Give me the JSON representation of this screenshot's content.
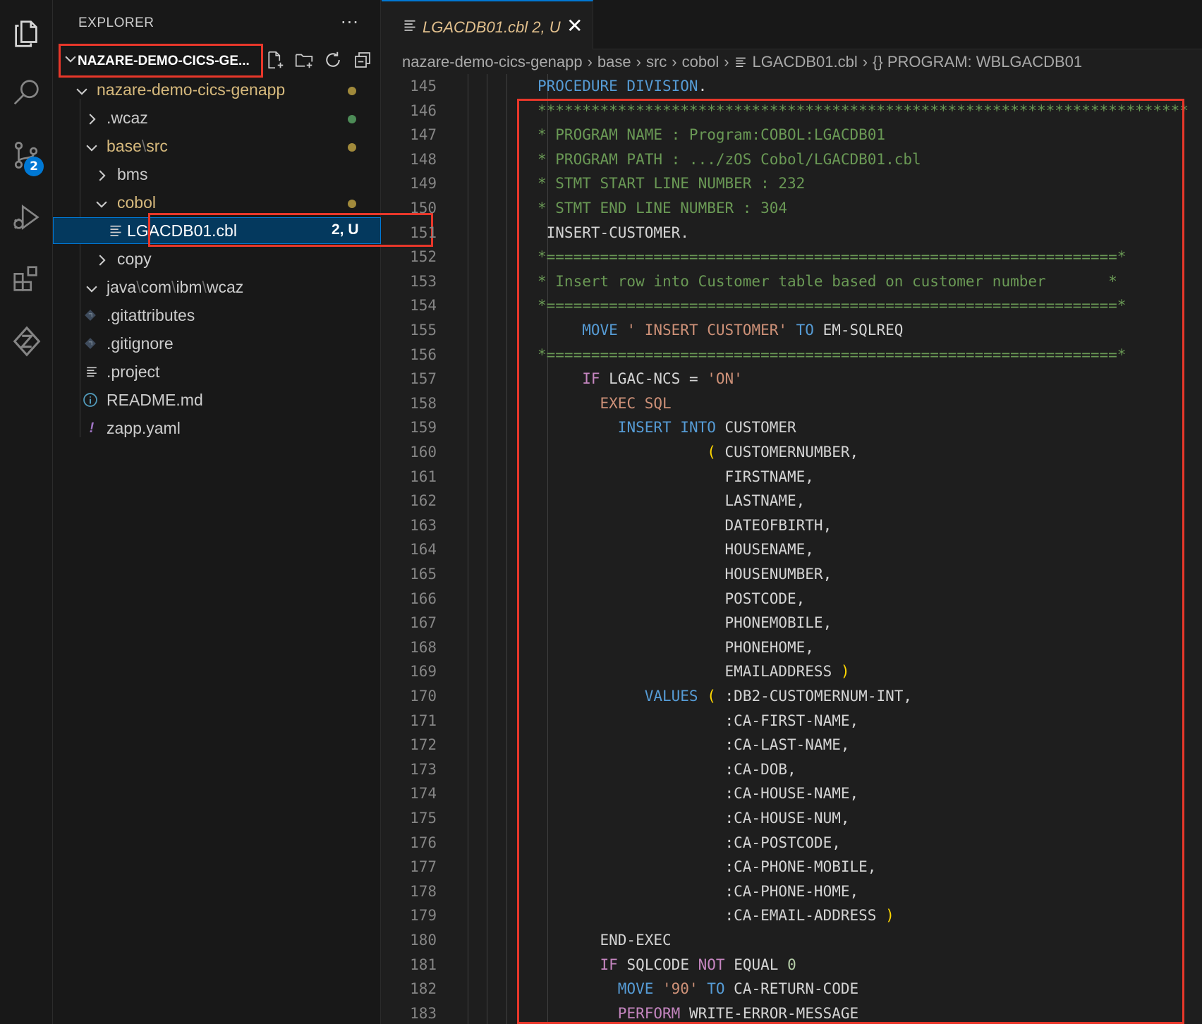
{
  "sidebar": {
    "title": "EXPLORER",
    "more": "···",
    "root": "NAZARE-DEMO-CICS-GE...",
    "tree": [
      {
        "label": "nazare-demo-cics-genapp"
      },
      {
        "label": ".wcaz"
      },
      {
        "label_parts": [
          "base",
          "\\",
          "src"
        ]
      },
      {
        "label": "bms"
      },
      {
        "label": "cobol"
      },
      {
        "label": "LGACDB01.cbl",
        "badge": "2, U"
      },
      {
        "label": "copy"
      },
      {
        "label_parts": [
          "java",
          "\\",
          "com",
          "\\",
          "ibm",
          "\\",
          "wcaz"
        ]
      },
      {
        "label": ".gitattributes"
      },
      {
        "label": ".gitignore"
      },
      {
        "label": ".project"
      },
      {
        "label": "README.md"
      },
      {
        "label": "zapp.yaml",
        "icon_text": "!"
      }
    ]
  },
  "activity_bar": {
    "scm_badge": "2",
    "icons": [
      "explorer-icon",
      "search-icon",
      "source-control-icon",
      "run-debug-icon",
      "extensions-icon",
      "z-open-editor-icon"
    ]
  },
  "editor": {
    "tab": {
      "label": "LGACDB01.cbl 2, U",
      "close": "✕"
    },
    "breadcrumb": [
      "nazare-demo-cics-genapp",
      "base",
      "src",
      "cobol",
      "LGACDB01.cbl",
      "{} PROGRAM: WBLGACDB01"
    ],
    "line_numbers": [
      "145",
      "146",
      "147",
      "148",
      "149",
      "150",
      "151",
      "152",
      "153",
      "154",
      "155",
      "156",
      "157",
      "158",
      "159",
      "160",
      "161",
      "162",
      "163",
      "164",
      "165",
      "166",
      "167",
      "168",
      "169",
      "170",
      "171",
      "172",
      "173",
      "174",
      "175",
      "176",
      "177",
      "178",
      "179",
      "180",
      "181",
      "182",
      "183"
    ],
    "lines": [
      [
        {
          "t": "PROCEDURE DIVISION",
          "c": "kw"
        },
        {
          "t": ".",
          "c": "wh"
        }
      ],
      [
        {
          "t": "*************************************************************************",
          "c": "cm"
        }
      ],
      [
        {
          "t": "* PROGRAM NAME : Program:COBOL:LGACDB01",
          "c": "cm"
        }
      ],
      [
        {
          "t": "* PROGRAM PATH : .../zOS Cobol/LGACDB01.cbl",
          "c": "cm"
        }
      ],
      [
        {
          "t": "* STMT START LINE NUMBER : 232",
          "c": "cm"
        }
      ],
      [
        {
          "t": "* STMT END LINE NUMBER : 304",
          "c": "cm"
        }
      ],
      [
        {
          "t": " INSERT-CUSTOMER.",
          "c": "wh"
        }
      ],
      [
        {
          "t": "*================================================================*",
          "c": "cm"
        }
      ],
      [
        {
          "t": "* Insert row into Customer table based on customer number       *",
          "c": "cm"
        }
      ],
      [
        {
          "t": "*================================================================*",
          "c": "cm"
        }
      ],
      [
        {
          "t": "     ",
          "c": "wh"
        },
        {
          "t": "MOVE",
          "c": "kw"
        },
        {
          "t": " ' INSERT CUSTOMER'",
          "c": "str"
        },
        {
          "t": " TO",
          "c": "kw"
        },
        {
          "t": " EM-SQLREQ",
          "c": "wh"
        }
      ],
      [
        {
          "t": "*================================================================*",
          "c": "cm"
        }
      ],
      [
        {
          "t": "     ",
          "c": "wh"
        },
        {
          "t": "IF",
          "c": "pur"
        },
        {
          "t": " LGAC-NCS = ",
          "c": "wh"
        },
        {
          "t": "'ON'",
          "c": "str"
        }
      ],
      [
        {
          "t": "       ",
          "c": "wh"
        },
        {
          "t": "EXEC SQL",
          "c": "str"
        }
      ],
      [
        {
          "t": "         ",
          "c": "wh"
        },
        {
          "t": "INSERT INTO",
          "c": "kw"
        },
        {
          "t": " CUSTOMER",
          "c": "wh"
        }
      ],
      [
        {
          "t": "                   ",
          "c": "wh"
        },
        {
          "t": "(",
          "c": "par"
        },
        {
          "t": " CUSTOMERNUMBER,",
          "c": "wh"
        }
      ],
      [
        {
          "t": "                     FIRSTNAME,",
          "c": "wh"
        }
      ],
      [
        {
          "t": "                     LASTNAME,",
          "c": "wh"
        }
      ],
      [
        {
          "t": "                     DATEOFBIRTH,",
          "c": "wh"
        }
      ],
      [
        {
          "t": "                     HOUSENAME,",
          "c": "wh"
        }
      ],
      [
        {
          "t": "                     HOUSENUMBER,",
          "c": "wh"
        }
      ],
      [
        {
          "t": "                     POSTCODE,",
          "c": "wh"
        }
      ],
      [
        {
          "t": "                     PHONEMOBILE,",
          "c": "wh"
        }
      ],
      [
        {
          "t": "                     PHONEHOME,",
          "c": "wh"
        }
      ],
      [
        {
          "t": "                     EMAILADDRESS ",
          "c": "wh"
        },
        {
          "t": ")",
          "c": "par"
        }
      ],
      [
        {
          "t": "            ",
          "c": "wh"
        },
        {
          "t": "VALUES",
          "c": "kw"
        },
        {
          "t": " ",
          "c": "wh"
        },
        {
          "t": "(",
          "c": "par"
        },
        {
          "t": " :DB2-CUSTOMERNUM-INT,",
          "c": "wh"
        }
      ],
      [
        {
          "t": "                     :CA-FIRST-NAME,",
          "c": "wh"
        }
      ],
      [
        {
          "t": "                     :CA-LAST-NAME,",
          "c": "wh"
        }
      ],
      [
        {
          "t": "                     :CA-DOB,",
          "c": "wh"
        }
      ],
      [
        {
          "t": "                     :CA-HOUSE-NAME,",
          "c": "wh"
        }
      ],
      [
        {
          "t": "                     :CA-HOUSE-NUM,",
          "c": "wh"
        }
      ],
      [
        {
          "t": "                     :CA-POSTCODE,",
          "c": "wh"
        }
      ],
      [
        {
          "t": "                     :CA-PHONE-MOBILE,",
          "c": "wh"
        }
      ],
      [
        {
          "t": "                     :CA-PHONE-HOME,",
          "c": "wh"
        }
      ],
      [
        {
          "t": "                     :CA-EMAIL-ADDRESS ",
          "c": "wh"
        },
        {
          "t": ")",
          "c": "par"
        }
      ],
      [
        {
          "t": "       END-EXEC",
          "c": "wh"
        }
      ],
      [
        {
          "t": "       ",
          "c": "wh"
        },
        {
          "t": "IF",
          "c": "pur"
        },
        {
          "t": " SQLCODE ",
          "c": "wh"
        },
        {
          "t": "NOT",
          "c": "pur"
        },
        {
          "t": " EQUAL ",
          "c": "wh"
        },
        {
          "t": "0",
          "c": "num"
        }
      ],
      [
        {
          "t": "         ",
          "c": "wh"
        },
        {
          "t": "MOVE",
          "c": "kw"
        },
        {
          "t": " '90'",
          "c": "str"
        },
        {
          "t": " TO",
          "c": "kw"
        },
        {
          "t": " CA-RETURN-CODE",
          "c": "wh"
        }
      ],
      [
        {
          "t": "         ",
          "c": "wh"
        },
        {
          "t": "PERFORM",
          "c": "pur"
        },
        {
          "t": " WRITE-ERROR-MESSAGE",
          "c": "wh"
        }
      ]
    ]
  },
  "colors": {
    "highlight": "#e8372a",
    "accent": "#0078d4",
    "git_modified": "#a18a3b",
    "git_untracked": "#4d8c57"
  }
}
